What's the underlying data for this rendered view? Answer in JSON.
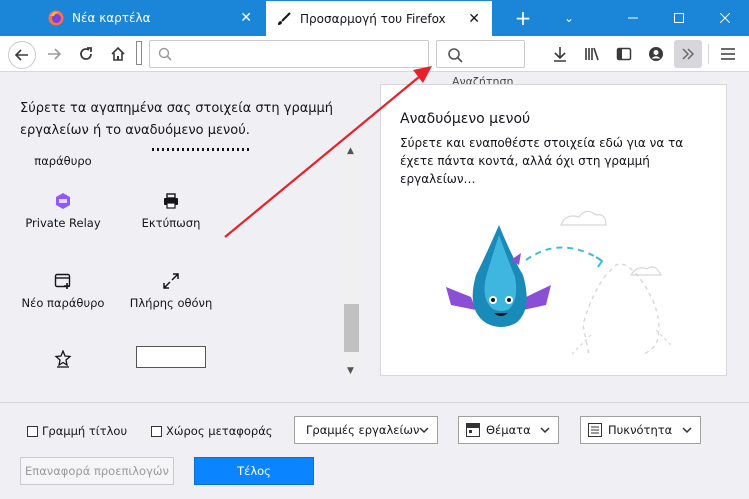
{
  "tabs": [
    {
      "label": "Νέα καρτέλα"
    },
    {
      "label": "Προσαρμογή του Firefox"
    }
  ],
  "navbar": {
    "search_tooltip": "Αναζήτηση"
  },
  "customize": {
    "instructions": "Σύρετε τα αγαπημένα σας στοιχεία στη γραμμή εργαλείων ή το αναδυόμενο μενού.",
    "palette": [
      {
        "label": "παράθυρο",
        "icon": "window-icon"
      },
      {
        "label": "Private Relay",
        "icon": "private-relay-icon"
      },
      {
        "label": "Εκτύπωση",
        "icon": "print-icon"
      },
      {
        "label": "Νέο παράθυρο",
        "icon": "new-window-icon"
      },
      {
        "label": "Πλήρης οθόνη",
        "icon": "fullscreen-icon"
      },
      {
        "label": "",
        "icon": "bookmark-star-icon"
      }
    ]
  },
  "overflow_panel": {
    "title": "Αναδυόμενο μενού",
    "description": "Σύρετε και εναποθέστε στοιχεία εδώ για να τα έχετε πάντα κοντά, αλλά όχι στη γραμμή εργαλείων…"
  },
  "footer": {
    "title_bar_label": "Γραμμή τίτλου",
    "drag_space_label": "Χώρος μεταφοράς",
    "toolbars_label": "Γραμμές εργαλείων",
    "themes_label": "Θέματα",
    "density_label": "Πυκνότητα",
    "restore_defaults_label": "Επαναφορά προεπιλογών",
    "done_label": "Τέλος"
  },
  "colors": {
    "titlebar": "#1b86d8",
    "accent_button": "#0a84ff",
    "arrow": "#e8202a"
  }
}
